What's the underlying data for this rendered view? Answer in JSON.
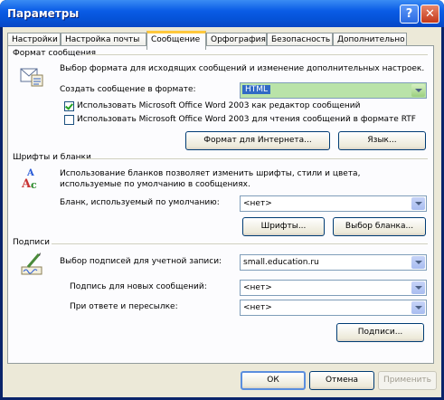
{
  "window": {
    "title": "Параметры"
  },
  "tabs": [
    {
      "label": "Настройки"
    },
    {
      "label": "Настройка почты"
    },
    {
      "label": "Сообщение"
    },
    {
      "label": "Орфография"
    },
    {
      "label": "Безопасность"
    },
    {
      "label": "Дополнительно"
    }
  ],
  "active_tab": "Сообщение",
  "message_format": {
    "title": "Формат сообщения",
    "description": "Выбор формата для исходящих сообщений и изменение дополнительных настроек.",
    "compose_label": "Создать сообщение в формате:",
    "compose_value": "HTML",
    "use_word_editor_label": "Использовать Microsoft Office Word 2003 как редактор сообщений",
    "use_word_editor_checked": true,
    "use_word_rtf_label": "Использовать Microsoft Office Word 2003 для чтения сообщений в формате RTF",
    "use_word_rtf_checked": false,
    "internet_format_button": "Формат для Интернета...",
    "language_button": "Язык..."
  },
  "fonts_stationery": {
    "title": "Шрифты и бланки",
    "description": "Использование бланков позволяет изменить шрифты, стили и цвета, используемые по умолчанию в сообщениях.",
    "default_stationery_label": "Бланк, используемый по умолчанию:",
    "default_stationery_value": "<нет>",
    "fonts_button": "Шрифты...",
    "stationery_picker_button": "Выбор бланка..."
  },
  "signatures": {
    "title": "Подписи",
    "account_label": "Выбор подписей для учетной записи:",
    "account_value": "small.education.ru",
    "new_messages_label": "Подпись для новых сообщений:",
    "new_messages_value": "<нет>",
    "replies_label": "При ответе и пересылке:",
    "replies_value": "<нет>",
    "signatures_button": "Подписи..."
  },
  "footer": {
    "ok": "ОК",
    "cancel": "Отмена",
    "apply": "Применить"
  }
}
